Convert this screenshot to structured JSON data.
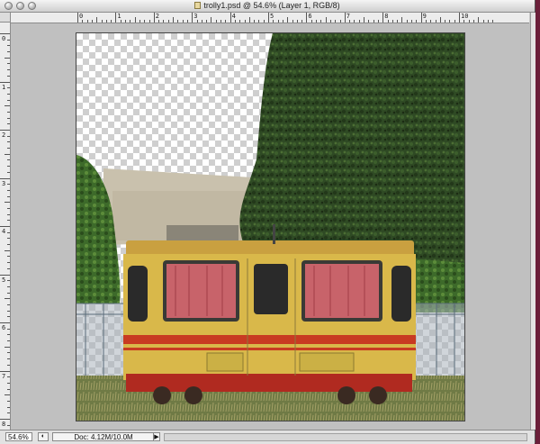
{
  "window": {
    "title": "trolly1.psd @ 54.6% (Layer 1, RGB/8)"
  },
  "ruler": {
    "h_labels": [
      "0",
      "1",
      "2",
      "3",
      "4",
      "5",
      "6",
      "7",
      "8",
      "9",
      "10"
    ],
    "v_labels": [
      "0",
      "1",
      "2",
      "3",
      "4",
      "5",
      "6",
      "7",
      "8"
    ]
  },
  "status": {
    "zoom": "54.6%",
    "doc_size": "Doc: 4.12M/10.0M",
    "arrow": "▶"
  },
  "icons": {
    "status_button": "◐"
  },
  "colors": {
    "trolley_body": "#d9b84a",
    "trolley_stripe": "#c83a22",
    "curtains": "#c8636a",
    "hedge": "#2e4a22",
    "wall": "#c9c1ad"
  }
}
